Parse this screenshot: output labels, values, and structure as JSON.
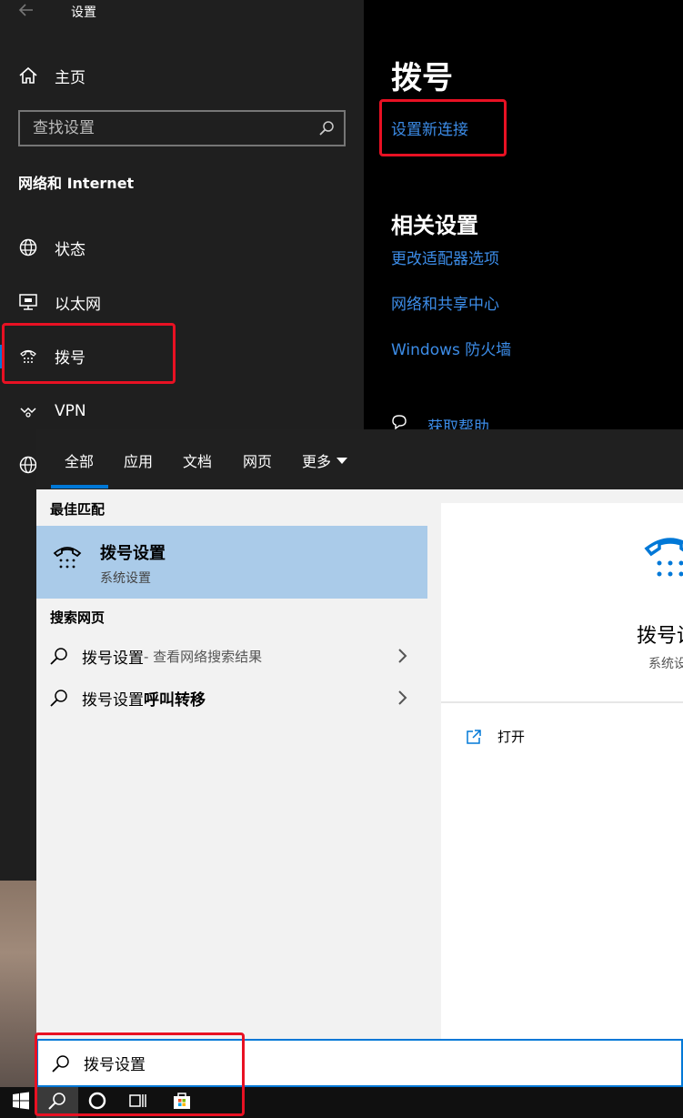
{
  "settings": {
    "window_title": "设置",
    "home_label": "主页",
    "search_placeholder": "查找设置",
    "section": "网络和 Internet",
    "nav": [
      {
        "label": "状态",
        "icon": "globe-status-icon"
      },
      {
        "label": "以太网",
        "icon": "ethernet-icon"
      },
      {
        "label": "拨号",
        "icon": "dialup-icon",
        "active": true
      },
      {
        "label": "VPN",
        "icon": "vpn-icon"
      }
    ],
    "page_title": "拨号",
    "new_connection_link": "设置新连接",
    "related_heading": "相关设置",
    "related_links": [
      "更改适配器选项",
      "网络和共享中心",
      "Windows 防火墙"
    ],
    "help_link": "获取帮助",
    "accent_color": "#0078d7",
    "link_color": "#3c8ce7",
    "highlight_color": "#e81123"
  },
  "search": {
    "tabs": [
      {
        "label": "全部",
        "active": true
      },
      {
        "label": "应用"
      },
      {
        "label": "文档"
      },
      {
        "label": "网页"
      },
      {
        "label": "更多"
      }
    ],
    "best_match_heading": "最佳匹配",
    "best_match": {
      "name": "拨号设置",
      "type": "系统设置"
    },
    "web_heading": "搜索网页",
    "web_results": [
      {
        "query": "拨号设置",
        "suffix": " - 查看网络搜索结果",
        "bold_extra": ""
      },
      {
        "query": "拨号设置",
        "suffix": "",
        "bold_extra": "呼叫转移"
      }
    ],
    "detail": {
      "name": "拨号设",
      "type": "系统设"
    },
    "open_label": "打开",
    "query": "拨号设置"
  }
}
